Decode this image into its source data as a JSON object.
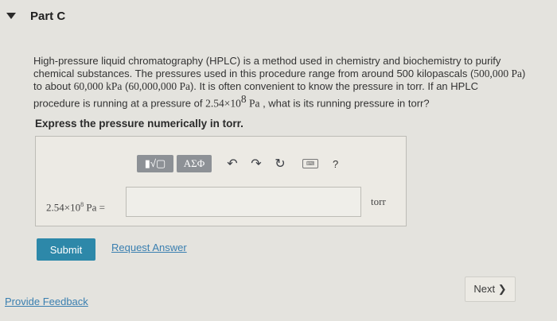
{
  "header": {
    "title": "Part C"
  },
  "question": {
    "l1": "High-pressure liquid chromatography (HPLC) is a method used in chemistry and biochemistry to purify",
    "l2a": "chemical substances. The pressures used in this procedure range from around 500 kilopascals (",
    "l2m": "500,000 Pa",
    "l2b": ")",
    "l3a": "to about ",
    "l3m1": "60,000 kPa",
    "l3b": " (",
    "l3m2": "60,000,000 Pa",
    "l3c": "). It is often convenient to know the pressure in torr. If an HPLC",
    "l4a": "procedure is running at a pressure of ",
    "l4base": "2.54×10",
    "l4exp": "8",
    "l4unit": " Pa",
    "l4b": " , what is its running pressure in torr?"
  },
  "instruction": "Express the pressure numerically in torr.",
  "toolbar": {
    "templates_label": "▮√▢",
    "greek_label": "ΑΣΦ",
    "undo_glyph": "↶",
    "redo_glyph": "↷",
    "reset_glyph": "↻",
    "keyboard_label": "⌨",
    "help_label": "?"
  },
  "answer": {
    "expr_base": "2.54×10",
    "expr_exp": "8",
    "expr_tail": " Pa =",
    "value": "",
    "unit": "torr"
  },
  "buttons": {
    "submit": "Submit",
    "request_answer": "Request Answer",
    "next": "Next ❯",
    "feedback": "Provide Feedback"
  }
}
